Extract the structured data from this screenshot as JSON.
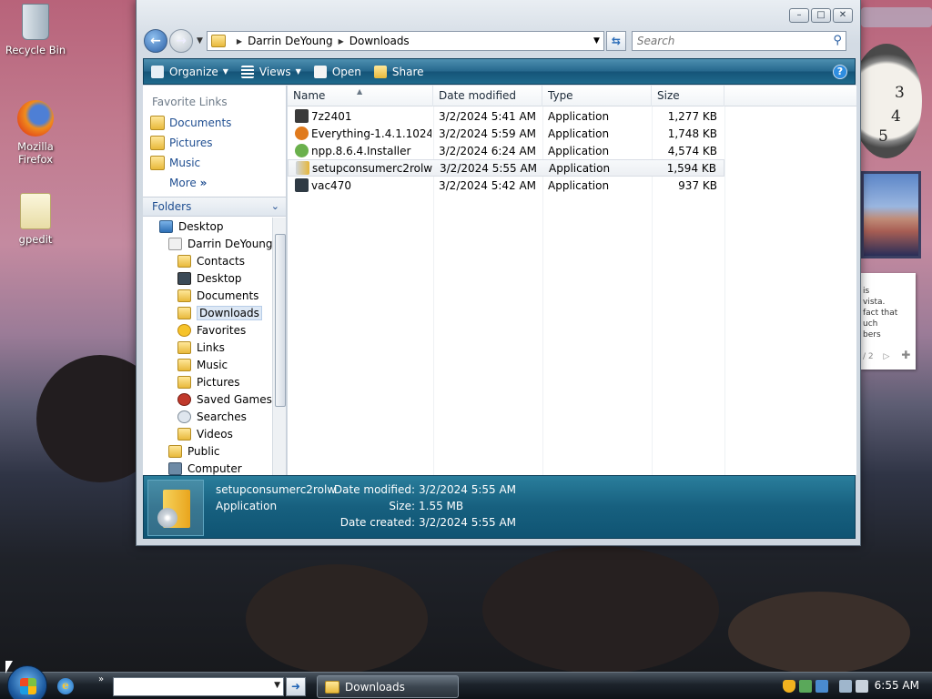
{
  "desktop": {
    "icons": [
      {
        "label": "Recycle Bin",
        "icon": "recycle-bin-icon"
      },
      {
        "label": "Mozilla Firefox",
        "icon": "firefox-icon"
      },
      {
        "label": "gpedit",
        "icon": "document-icon"
      }
    ]
  },
  "window": {
    "title_buttons": {
      "minimize": "–",
      "maximize": "□",
      "close": "✕"
    },
    "address": {
      "crumbs": [
        "Darrin DeYoung",
        "Downloads"
      ]
    },
    "search": {
      "placeholder": "Search"
    },
    "toolbar": {
      "organize": "Organize",
      "views": "Views",
      "open": "Open",
      "share": "Share",
      "help": "?"
    },
    "nav_pane": {
      "favorite_links_title": "Favorite Links",
      "favorite_links": [
        "Documents",
        "Pictures",
        "Music"
      ],
      "more": "More",
      "folders_title": "Folders",
      "tree": [
        {
          "label": "Desktop",
          "indent": 0
        },
        {
          "label": "Darrin DeYoung",
          "indent": 1
        },
        {
          "label": "Contacts",
          "indent": 2
        },
        {
          "label": "Desktop",
          "indent": 2
        },
        {
          "label": "Documents",
          "indent": 2
        },
        {
          "label": "Downloads",
          "indent": 2,
          "selected": true
        },
        {
          "label": "Favorites",
          "indent": 2
        },
        {
          "label": "Links",
          "indent": 2
        },
        {
          "label": "Music",
          "indent": 2
        },
        {
          "label": "Pictures",
          "indent": 2
        },
        {
          "label": "Saved Games",
          "indent": 2
        },
        {
          "label": "Searches",
          "indent": 2
        },
        {
          "label": "Videos",
          "indent": 2
        },
        {
          "label": "Public",
          "indent": 1
        },
        {
          "label": "Computer",
          "indent": 1
        }
      ]
    },
    "columns": {
      "name": "Name",
      "date_modified": "Date modified",
      "type": "Type",
      "size": "Size"
    },
    "files": [
      {
        "name": "7z2401",
        "date": "3/2/2024 5:41 AM",
        "type": "Application",
        "size": "1,277 KB",
        "icon": "7zip-icon",
        "color": "#3a3a3a"
      },
      {
        "name": "Everything-1.4.1.1024.x...",
        "date": "3/2/2024 5:59 AM",
        "type": "Application",
        "size": "1,748 KB",
        "icon": "everything-search-icon",
        "color": "#e07a1c"
      },
      {
        "name": "npp.8.6.4.Installer",
        "date": "3/2/2024 6:24 AM",
        "type": "Application",
        "size": "4,574 KB",
        "icon": "notepad-plus-plus-icon",
        "color": "#6ab04c"
      },
      {
        "name": "setupconsumerc2rolw",
        "date": "3/2/2024 5:55 AM",
        "type": "Application",
        "size": "1,594 KB",
        "icon": "installer-icon",
        "color": "#e6b63a",
        "highlighted": true
      },
      {
        "name": "vac470",
        "date": "3/2/2024 5:42 AM",
        "type": "Application",
        "size": "937 KB",
        "icon": "vac-icon",
        "color": "#2f3a44"
      }
    ],
    "details": {
      "name": "setupconsumerc2rolw",
      "type": "Application",
      "date_modified_label": "Date modified:",
      "date_modified": "3/2/2024 5:55 AM",
      "size_label": "Size:",
      "size": "1.55 MB",
      "date_created_label": "Date created:",
      "date_created": "3/2/2024 5:55 AM"
    }
  },
  "gadgets": {
    "clock_numbers": [
      "3",
      "4",
      "5"
    ],
    "notes_text": [
      "is",
      "vista.",
      "fact that",
      "uch",
      "bers"
    ],
    "notes_page": "/ 2"
  },
  "taskbar": {
    "task_button": "Downloads",
    "time": "6:55 AM",
    "more": "»"
  }
}
